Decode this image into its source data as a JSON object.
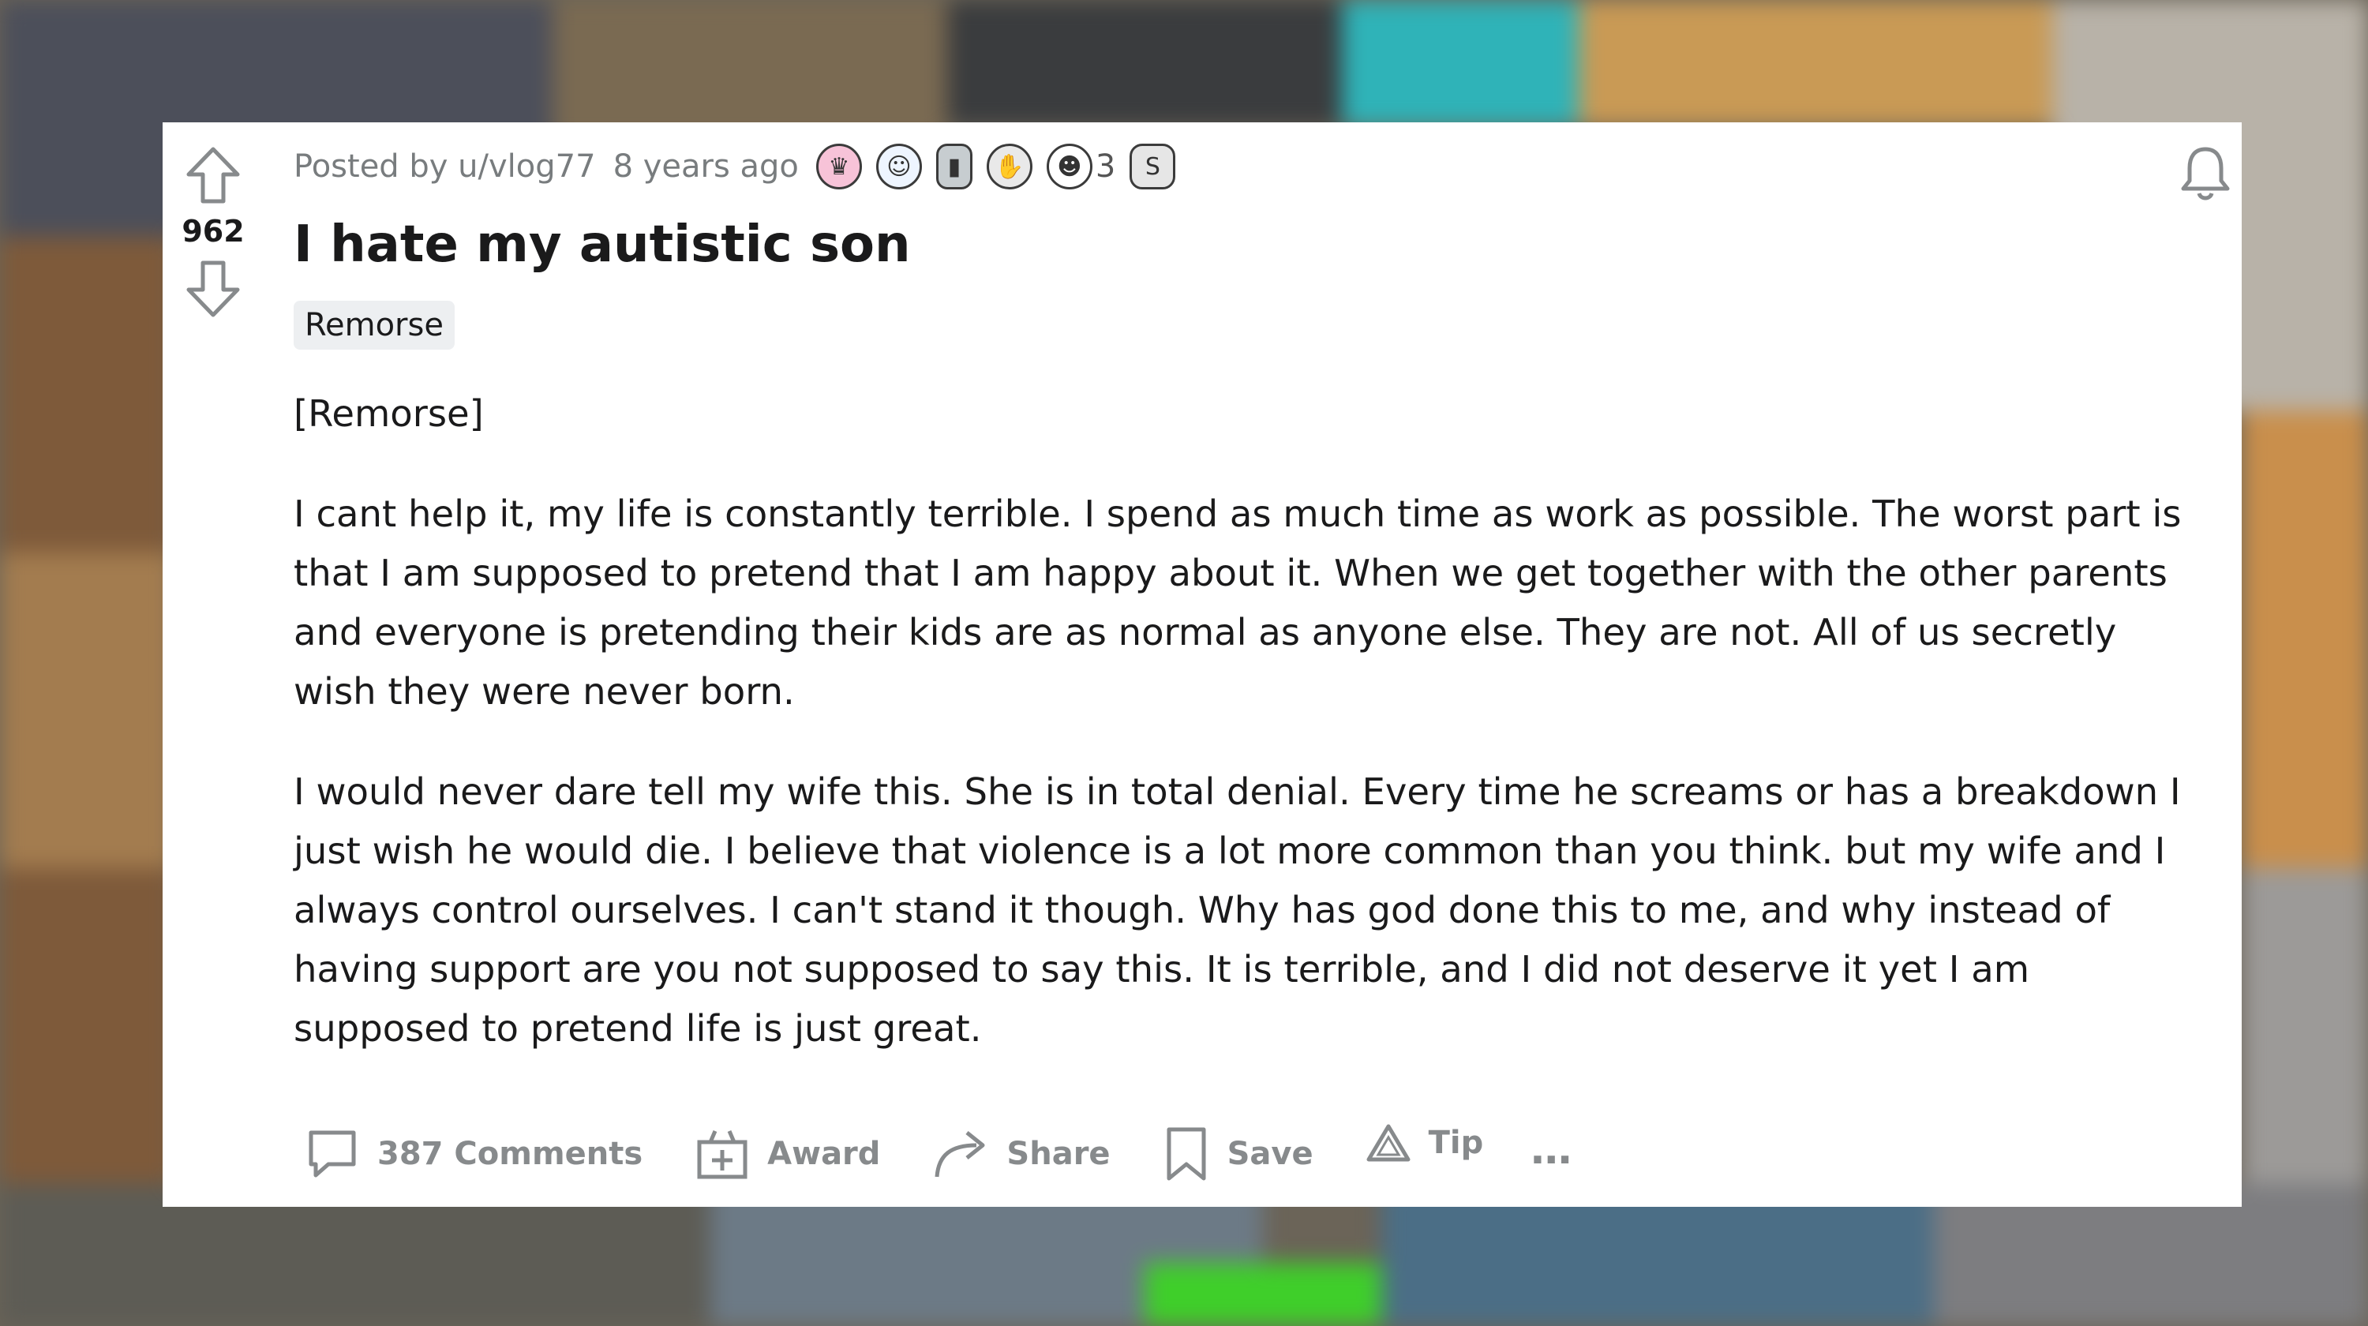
{
  "post": {
    "score": "962",
    "meta": {
      "posted_by": "Posted by u/vlog77",
      "age": "8 years ago",
      "award_count": "3",
      "awards": [
        "queen-award-icon",
        "wholesome-face-award-icon",
        "moai-award-icon",
        "handshake-award-icon",
        "laughing-face-award-icon",
        "silver-coin-award-icon"
      ]
    },
    "title": "I hate my autistic son",
    "flair": "Remorse",
    "body": {
      "p1": "[Remorse]",
      "p2": "I cant help it, my life is constantly terrible. I spend as much time as work as possible. The worst part is that I am supposed to pretend that I am happy about it. When we get together with the other parents and everyone is pretending their kids are as normal as anyone else. They are not. All of us secretly wish they were never born.",
      "p3": "I would never dare tell my wife this. She is in total denial. Every time he screams or has a breakdown I just wish he would die. I believe that violence is a lot more common than you think. but my wife and I always control ourselves. I can't stand it though. Why has god done this to me, and why instead of having support are you not supposed to say this. It is terrible, and I did not deserve it yet I am supposed to pretend life is just great."
    },
    "actions": {
      "comments": "387 Comments",
      "award": "Award",
      "share": "Share",
      "save": "Save",
      "tip": "Tip",
      "more": "…"
    }
  },
  "colors": {
    "card": "#ffffff",
    "text": "#1a1a1b",
    "meta": "#787c7e",
    "action": "#878a8c",
    "flair_bg": "#edeff1"
  }
}
